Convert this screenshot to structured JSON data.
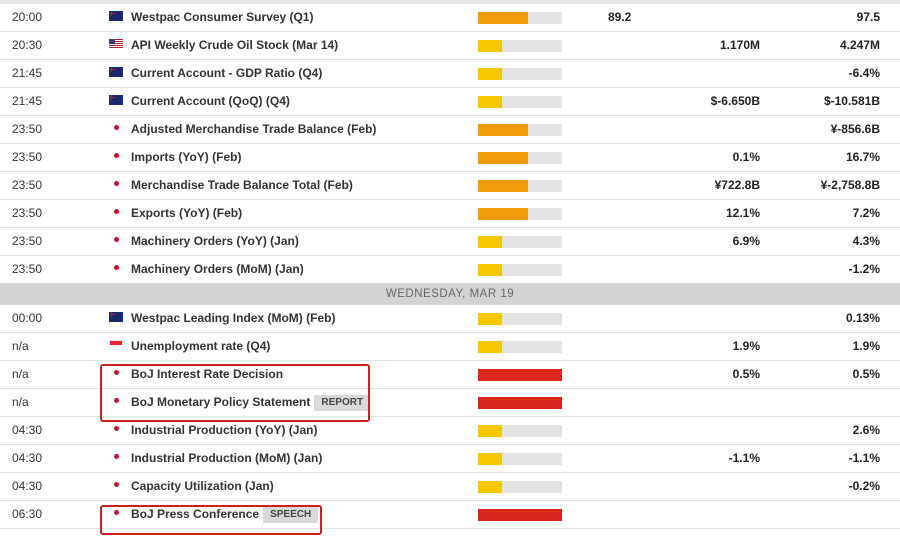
{
  "colors": {
    "impact_low": "#f5c800",
    "impact_medium": "#f29b0d",
    "impact_high": "#d9261c",
    "highlight_border": "#cc1f1f",
    "day_header_bg": "#d3d3d3"
  },
  "rows_before": [
    {
      "time": "20:00",
      "flag": "nz-flag-icon",
      "event": "Westpac Consumer Survey (Q1)",
      "impact": "medium",
      "actual": "89.2",
      "forecast": "",
      "previous": "97.5"
    },
    {
      "time": "20:30",
      "flag": "us-flag-icon",
      "event": "API Weekly Crude Oil Stock (Mar 14)",
      "impact": "low",
      "actual": "",
      "forecast": "1.170M",
      "previous": "4.247M"
    },
    {
      "time": "21:45",
      "flag": "nz-flag-icon",
      "event": "Current Account - GDP Ratio (Q4)",
      "impact": "low",
      "actual": "",
      "forecast": "",
      "previous": "-6.4%"
    },
    {
      "time": "21:45",
      "flag": "nz-flag-icon",
      "event": "Current Account (QoQ) (Q4)",
      "impact": "low",
      "actual": "",
      "forecast": "$-6.650B",
      "previous": "$-10.581B"
    },
    {
      "time": "23:50",
      "flag": "jp-flag-icon",
      "event": "Adjusted Merchandise Trade Balance (Feb)",
      "impact": "medium",
      "actual": "",
      "forecast": "",
      "previous": "¥-856.6B"
    },
    {
      "time": "23:50",
      "flag": "jp-flag-icon",
      "event": "Imports (YoY) (Feb)",
      "impact": "medium",
      "actual": "",
      "forecast": "0.1%",
      "previous": "16.7%"
    },
    {
      "time": "23:50",
      "flag": "jp-flag-icon",
      "event": "Merchandise Trade Balance Total (Feb)",
      "impact": "medium",
      "actual": "",
      "forecast": "¥722.8B",
      "previous": "¥-2,758.8B"
    },
    {
      "time": "23:50",
      "flag": "jp-flag-icon",
      "event": "Exports (YoY) (Feb)",
      "impact": "medium",
      "actual": "",
      "forecast": "12.1%",
      "previous": "7.2%"
    },
    {
      "time": "23:50",
      "flag": "jp-flag-icon",
      "event": "Machinery Orders (YoY) (Jan)",
      "impact": "low",
      "actual": "",
      "forecast": "6.9%",
      "previous": "4.3%"
    },
    {
      "time": "23:50",
      "flag": "jp-flag-icon",
      "event": "Machinery Orders (MoM) (Jan)",
      "impact": "low",
      "actual": "",
      "forecast": "",
      "previous": "-1.2%"
    }
  ],
  "day_header": "WEDNESDAY, MAR 19",
  "rows_after": [
    {
      "time": "00:00",
      "flag": "nz-flag-icon",
      "event": "Westpac Leading Index (MoM) (Feb)",
      "impact": "low",
      "actual": "",
      "forecast": "",
      "previous": "0.13%"
    },
    {
      "time": "n/a",
      "flag": "sg-flag-icon",
      "event": "Unemployment rate (Q4)",
      "impact": "low",
      "actual": "",
      "forecast": "1.9%",
      "previous": "1.9%"
    },
    {
      "time": "n/a",
      "flag": "jp-flag-icon",
      "event": "BoJ Interest Rate Decision",
      "impact": "high",
      "actual": "",
      "forecast": "0.5%",
      "previous": "0.5%"
    },
    {
      "time": "n/a",
      "flag": "jp-flag-icon",
      "event": "BoJ Monetary Policy Statement",
      "badge": "REPORT",
      "impact": "high",
      "actual": "",
      "forecast": "",
      "previous": ""
    },
    {
      "time": "04:30",
      "flag": "jp-flag-icon",
      "event": "Industrial Production (YoY) (Jan)",
      "impact": "low",
      "actual": "",
      "forecast": "",
      "previous": "2.6%"
    },
    {
      "time": "04:30",
      "flag": "jp-flag-icon",
      "event": "Industrial Production (MoM) (Jan)",
      "impact": "low",
      "actual": "",
      "forecast": "-1.1%",
      "previous": "-1.1%"
    },
    {
      "time": "04:30",
      "flag": "jp-flag-icon",
      "event": "Capacity Utilization (Jan)",
      "impact": "low",
      "actual": "",
      "forecast": "",
      "previous": "-0.2%"
    },
    {
      "time": "06:30",
      "flag": "jp-flag-icon",
      "event": "BoJ Press Conference",
      "badge": "SPEECH",
      "impact": "high",
      "actual": "",
      "forecast": "",
      "previous": ""
    }
  ]
}
